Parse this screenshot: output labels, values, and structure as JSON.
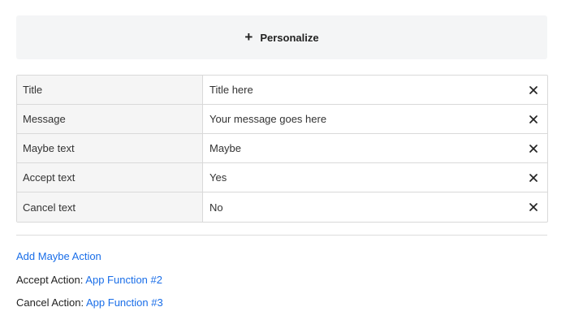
{
  "personalize": {
    "icon": "plus-icon",
    "label": "Personalize"
  },
  "fields": [
    {
      "label": "Title",
      "value": "Title here"
    },
    {
      "label": "Message",
      "value": "Your message goes here"
    },
    {
      "label": "Maybe text",
      "value": "Maybe"
    },
    {
      "label": "Accept text",
      "value": "Yes"
    },
    {
      "label": "Cancel text",
      "value": "No"
    }
  ],
  "clear_icon": "close-icon",
  "actions": {
    "add_maybe": "Add Maybe Action",
    "accept_label": "Accept Action:",
    "accept_value": "App Function #2",
    "cancel_label": "Cancel Action:",
    "cancel_value": "App Function #3"
  },
  "colors": {
    "link": "#1a6ee8",
    "button_bg": "#f4f5f6",
    "label_cell_bg": "#f5f5f5",
    "border": "#d9d9d9"
  }
}
